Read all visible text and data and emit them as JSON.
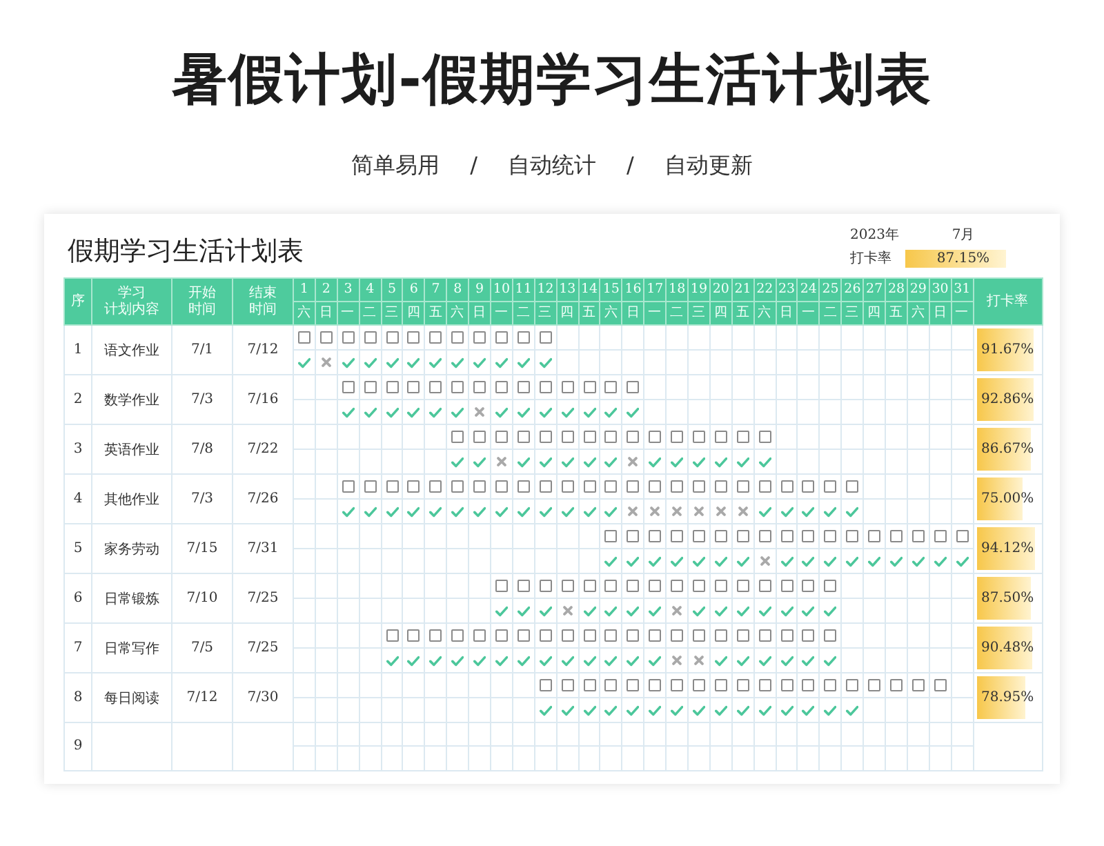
{
  "title": "暑假计划-假期学习生活计划表",
  "subtitle": [
    "简单易用",
    "/",
    "自动统计",
    "/",
    "自动更新"
  ],
  "sheet": {
    "title": "假期学习生活计划表",
    "year": "2023年",
    "month": "7月",
    "rate_label": "打卡率",
    "rate": {
      "value": "87.15%",
      "level": 0.8715
    },
    "columns": {
      "index": [
        "序"
      ],
      "task": [
        "学习",
        "计划内容"
      ],
      "start": [
        "开始",
        "时间"
      ],
      "end": [
        "结束",
        "时间"
      ],
      "rate": [
        "打卡率"
      ]
    },
    "days": [
      {
        "date": "1",
        "weekday": "六"
      },
      {
        "date": "2",
        "weekday": "日"
      },
      {
        "date": "3",
        "weekday": "一"
      },
      {
        "date": "4",
        "weekday": "二"
      },
      {
        "date": "5",
        "weekday": "三"
      },
      {
        "date": "6",
        "weekday": "四"
      },
      {
        "date": "7",
        "weekday": "五"
      },
      {
        "date": "8",
        "weekday": "六"
      },
      {
        "date": "9",
        "weekday": "日"
      },
      {
        "date": "10",
        "weekday": "一"
      },
      {
        "date": "11",
        "weekday": "二"
      },
      {
        "date": "12",
        "weekday": "三"
      },
      {
        "date": "13",
        "weekday": "四"
      },
      {
        "date": "14",
        "weekday": "五"
      },
      {
        "date": "15",
        "weekday": "六"
      },
      {
        "date": "16",
        "weekday": "日"
      },
      {
        "date": "17",
        "weekday": "一"
      },
      {
        "date": "18",
        "weekday": "二"
      },
      {
        "date": "19",
        "weekday": "三"
      },
      {
        "date": "20",
        "weekday": "四"
      },
      {
        "date": "21",
        "weekday": "五"
      },
      {
        "date": "22",
        "weekday": "六"
      },
      {
        "date": "23",
        "weekday": "日"
      },
      {
        "date": "24",
        "weekday": "一"
      },
      {
        "date": "25",
        "weekday": "二"
      },
      {
        "date": "26",
        "weekday": "三"
      },
      {
        "date": "27",
        "weekday": "四"
      },
      {
        "date": "28",
        "weekday": "五"
      },
      {
        "date": "29",
        "weekday": "六"
      },
      {
        "date": "30",
        "weekday": "日"
      },
      {
        "date": "31",
        "weekday": "一"
      }
    ],
    "rows": [
      {
        "index": "1",
        "task": "语文作业",
        "start": "7/1",
        "end": "7/12",
        "rate": "91.67%",
        "level": 0.9167,
        "days": [
          {
            "kind": "done"
          },
          {
            "kind": "miss"
          },
          {
            "kind": "done"
          },
          {
            "kind": "done"
          },
          {
            "kind": "done"
          },
          {
            "kind": "done"
          },
          {
            "kind": "done"
          },
          {
            "kind": "done"
          },
          {
            "kind": "done"
          },
          {
            "kind": "done"
          },
          {
            "kind": "done"
          },
          {
            "kind": "done"
          },
          {
            "kind": "none"
          },
          {
            "kind": "none"
          },
          {
            "kind": "none"
          },
          {
            "kind": "none"
          },
          {
            "kind": "none"
          },
          {
            "kind": "none"
          },
          {
            "kind": "none"
          },
          {
            "kind": "none"
          },
          {
            "kind": "none"
          },
          {
            "kind": "none"
          },
          {
            "kind": "none"
          },
          {
            "kind": "none"
          },
          {
            "kind": "none"
          },
          {
            "kind": "none"
          },
          {
            "kind": "none"
          },
          {
            "kind": "none"
          },
          {
            "kind": "none"
          },
          {
            "kind": "none"
          },
          {
            "kind": "none"
          }
        ]
      },
      {
        "index": "2",
        "task": "数学作业",
        "start": "7/3",
        "end": "7/16",
        "rate": "92.86%",
        "level": 0.9286,
        "days": [
          {
            "kind": "none"
          },
          {
            "kind": "none"
          },
          {
            "kind": "done"
          },
          {
            "kind": "done"
          },
          {
            "kind": "done"
          },
          {
            "kind": "done"
          },
          {
            "kind": "done"
          },
          {
            "kind": "done"
          },
          {
            "kind": "miss"
          },
          {
            "kind": "done"
          },
          {
            "kind": "done"
          },
          {
            "kind": "done"
          },
          {
            "kind": "done"
          },
          {
            "kind": "done"
          },
          {
            "kind": "done"
          },
          {
            "kind": "done"
          },
          {
            "kind": "none"
          },
          {
            "kind": "none"
          },
          {
            "kind": "none"
          },
          {
            "kind": "none"
          },
          {
            "kind": "none"
          },
          {
            "kind": "none"
          },
          {
            "kind": "none"
          },
          {
            "kind": "none"
          },
          {
            "kind": "none"
          },
          {
            "kind": "none"
          },
          {
            "kind": "none"
          },
          {
            "kind": "none"
          },
          {
            "kind": "none"
          },
          {
            "kind": "none"
          },
          {
            "kind": "none"
          }
        ]
      },
      {
        "index": "3",
        "task": "英语作业",
        "start": "7/8",
        "end": "7/22",
        "rate": "86.67%",
        "level": 0.8667,
        "days": [
          {
            "kind": "none"
          },
          {
            "kind": "none"
          },
          {
            "kind": "none"
          },
          {
            "kind": "none"
          },
          {
            "kind": "none"
          },
          {
            "kind": "none"
          },
          {
            "kind": "none"
          },
          {
            "kind": "done"
          },
          {
            "kind": "done"
          },
          {
            "kind": "miss"
          },
          {
            "kind": "done"
          },
          {
            "kind": "done"
          },
          {
            "kind": "done"
          },
          {
            "kind": "done"
          },
          {
            "kind": "done"
          },
          {
            "kind": "miss"
          },
          {
            "kind": "done"
          },
          {
            "kind": "done"
          },
          {
            "kind": "done"
          },
          {
            "kind": "done"
          },
          {
            "kind": "done"
          },
          {
            "kind": "done"
          },
          {
            "kind": "none"
          },
          {
            "kind": "none"
          },
          {
            "kind": "none"
          },
          {
            "kind": "none"
          },
          {
            "kind": "none"
          },
          {
            "kind": "none"
          },
          {
            "kind": "none"
          },
          {
            "kind": "none"
          },
          {
            "kind": "none"
          }
        ]
      },
      {
        "index": "4",
        "task": "其他作业",
        "start": "7/3",
        "end": "7/26",
        "rate": "75.00%",
        "level": 0.75,
        "days": [
          {
            "kind": "none"
          },
          {
            "kind": "none"
          },
          {
            "kind": "done"
          },
          {
            "kind": "done"
          },
          {
            "kind": "done"
          },
          {
            "kind": "done"
          },
          {
            "kind": "done"
          },
          {
            "kind": "done"
          },
          {
            "kind": "done"
          },
          {
            "kind": "done"
          },
          {
            "kind": "done"
          },
          {
            "kind": "done"
          },
          {
            "kind": "done"
          },
          {
            "kind": "done"
          },
          {
            "kind": "done"
          },
          {
            "kind": "miss"
          },
          {
            "kind": "miss"
          },
          {
            "kind": "miss"
          },
          {
            "kind": "miss"
          },
          {
            "kind": "miss"
          },
          {
            "kind": "miss"
          },
          {
            "kind": "done"
          },
          {
            "kind": "done"
          },
          {
            "kind": "done"
          },
          {
            "kind": "done"
          },
          {
            "kind": "done"
          },
          {
            "kind": "none"
          },
          {
            "kind": "none"
          },
          {
            "kind": "none"
          },
          {
            "kind": "none"
          },
          {
            "kind": "none"
          }
        ]
      },
      {
        "index": "5",
        "task": "家务劳动",
        "start": "7/15",
        "end": "7/31",
        "rate": "94.12%",
        "level": 0.9412,
        "days": [
          {
            "kind": "none"
          },
          {
            "kind": "none"
          },
          {
            "kind": "none"
          },
          {
            "kind": "none"
          },
          {
            "kind": "none"
          },
          {
            "kind": "none"
          },
          {
            "kind": "none"
          },
          {
            "kind": "none"
          },
          {
            "kind": "none"
          },
          {
            "kind": "none"
          },
          {
            "kind": "none"
          },
          {
            "kind": "none"
          },
          {
            "kind": "none"
          },
          {
            "kind": "none"
          },
          {
            "kind": "done"
          },
          {
            "kind": "done"
          },
          {
            "kind": "done"
          },
          {
            "kind": "done"
          },
          {
            "kind": "done"
          },
          {
            "kind": "done"
          },
          {
            "kind": "done"
          },
          {
            "kind": "miss"
          },
          {
            "kind": "done"
          },
          {
            "kind": "done"
          },
          {
            "kind": "done"
          },
          {
            "kind": "done"
          },
          {
            "kind": "done"
          },
          {
            "kind": "done"
          },
          {
            "kind": "done"
          },
          {
            "kind": "done"
          },
          {
            "kind": "done"
          }
        ]
      },
      {
        "index": "6",
        "task": "日常锻炼",
        "start": "7/10",
        "end": "7/25",
        "rate": "87.50%",
        "level": 0.875,
        "days": [
          {
            "kind": "none"
          },
          {
            "kind": "none"
          },
          {
            "kind": "none"
          },
          {
            "kind": "none"
          },
          {
            "kind": "none"
          },
          {
            "kind": "none"
          },
          {
            "kind": "none"
          },
          {
            "kind": "none"
          },
          {
            "kind": "none"
          },
          {
            "kind": "done"
          },
          {
            "kind": "done"
          },
          {
            "kind": "done"
          },
          {
            "kind": "miss"
          },
          {
            "kind": "done"
          },
          {
            "kind": "done"
          },
          {
            "kind": "done"
          },
          {
            "kind": "done"
          },
          {
            "kind": "miss"
          },
          {
            "kind": "done"
          },
          {
            "kind": "done"
          },
          {
            "kind": "done"
          },
          {
            "kind": "done"
          },
          {
            "kind": "done"
          },
          {
            "kind": "done"
          },
          {
            "kind": "done"
          },
          {
            "kind": "none"
          },
          {
            "kind": "none"
          },
          {
            "kind": "none"
          },
          {
            "kind": "none"
          },
          {
            "kind": "none"
          },
          {
            "kind": "none"
          }
        ]
      },
      {
        "index": "7",
        "task": "日常写作",
        "start": "7/5",
        "end": "7/25",
        "rate": "90.48%",
        "level": 0.9048,
        "days": [
          {
            "kind": "none"
          },
          {
            "kind": "none"
          },
          {
            "kind": "none"
          },
          {
            "kind": "none"
          },
          {
            "kind": "done"
          },
          {
            "kind": "done"
          },
          {
            "kind": "done"
          },
          {
            "kind": "done"
          },
          {
            "kind": "done"
          },
          {
            "kind": "done"
          },
          {
            "kind": "done"
          },
          {
            "kind": "done"
          },
          {
            "kind": "done"
          },
          {
            "kind": "done"
          },
          {
            "kind": "done"
          },
          {
            "kind": "done"
          },
          {
            "kind": "done"
          },
          {
            "kind": "miss"
          },
          {
            "kind": "miss"
          },
          {
            "kind": "done"
          },
          {
            "kind": "done"
          },
          {
            "kind": "done"
          },
          {
            "kind": "done"
          },
          {
            "kind": "done"
          },
          {
            "kind": "done"
          },
          {
            "kind": "none"
          },
          {
            "kind": "none"
          },
          {
            "kind": "none"
          },
          {
            "kind": "none"
          },
          {
            "kind": "none"
          },
          {
            "kind": "none"
          }
        ]
      },
      {
        "index": "8",
        "task": "每日阅读",
        "start": "7/12",
        "end": "7/30",
        "rate": "78.95%",
        "level": 0.7895,
        "days": [
          {
            "kind": "none"
          },
          {
            "kind": "none"
          },
          {
            "kind": "none"
          },
          {
            "kind": "none"
          },
          {
            "kind": "none"
          },
          {
            "kind": "none"
          },
          {
            "kind": "none"
          },
          {
            "kind": "none"
          },
          {
            "kind": "none"
          },
          {
            "kind": "none"
          },
          {
            "kind": "none"
          },
          {
            "kind": "done"
          },
          {
            "kind": "done"
          },
          {
            "kind": "done"
          },
          {
            "kind": "done"
          },
          {
            "kind": "done"
          },
          {
            "kind": "done"
          },
          {
            "kind": "done"
          },
          {
            "kind": "done"
          },
          {
            "kind": "done"
          },
          {
            "kind": "done"
          },
          {
            "kind": "done"
          },
          {
            "kind": "done"
          },
          {
            "kind": "done"
          },
          {
            "kind": "done"
          },
          {
            "kind": "done"
          },
          {
            "kind": "open"
          },
          {
            "kind": "open"
          },
          {
            "kind": "open"
          },
          {
            "kind": "open"
          },
          {
            "kind": "none"
          }
        ]
      },
      {
        "index": "9"
      }
    ]
  }
}
